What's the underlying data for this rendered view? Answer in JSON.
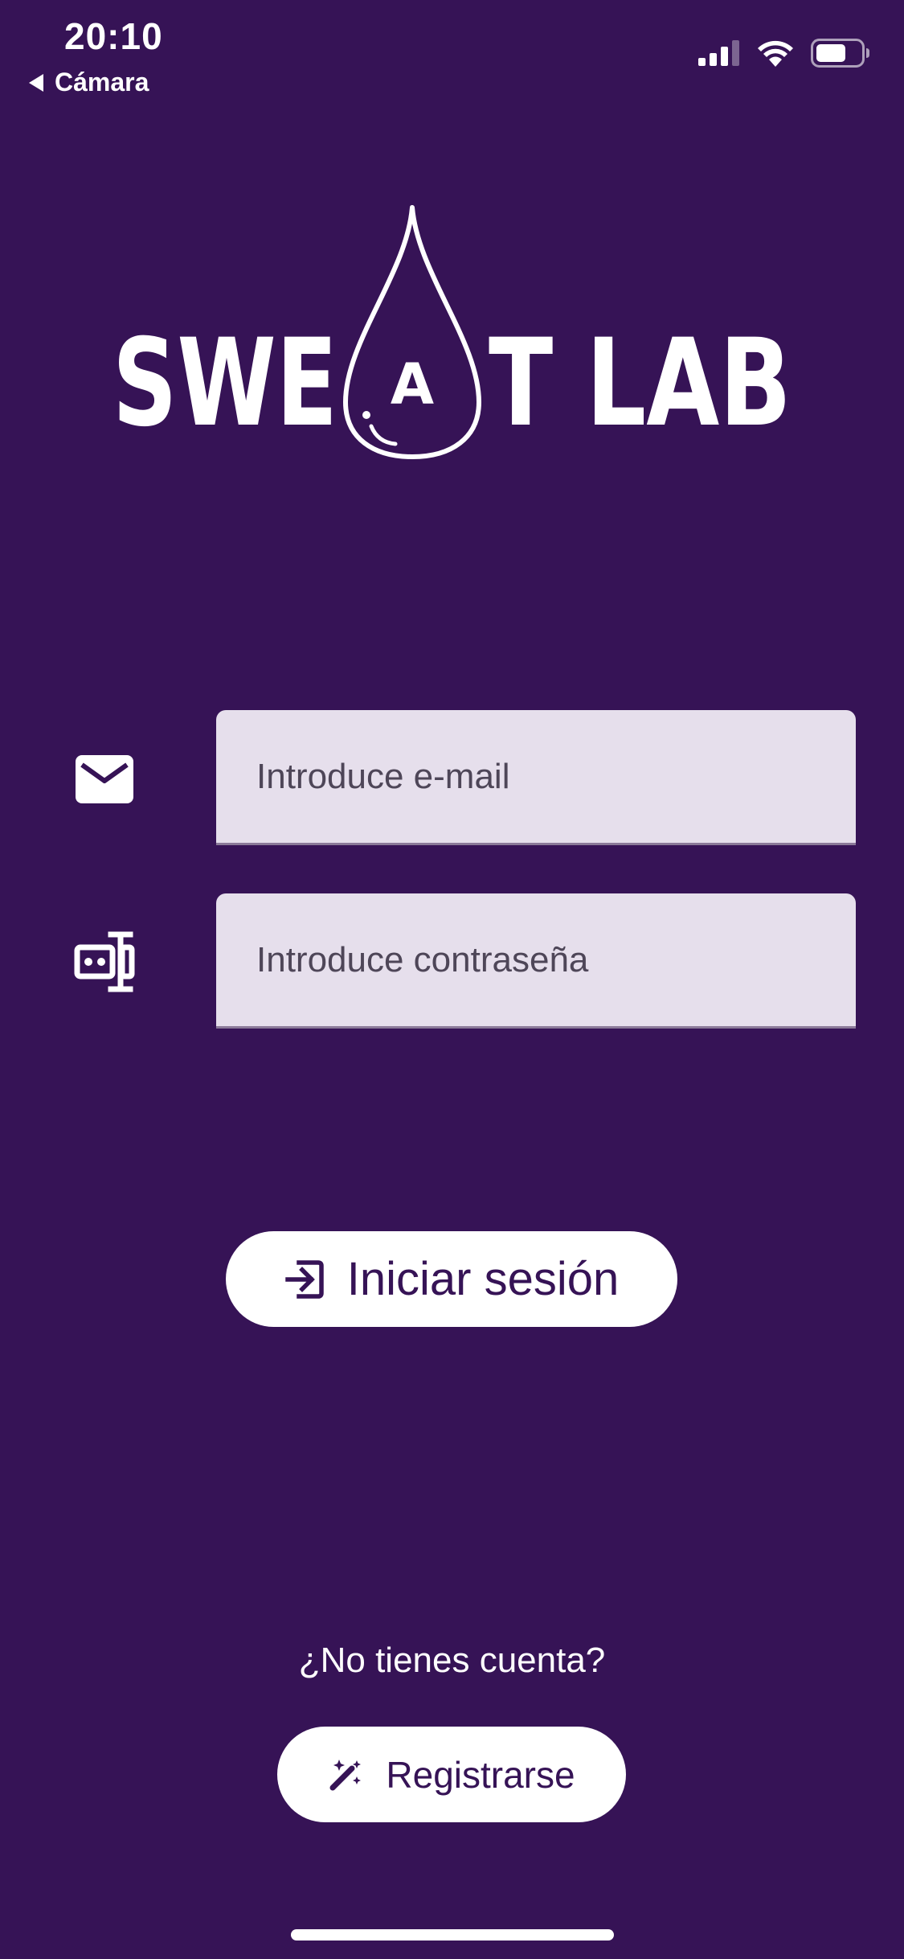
{
  "status_bar": {
    "time": "20:10",
    "back_label": "Cámara",
    "signal_icon": "cellular-signal-icon",
    "wifi_icon": "wifi-icon",
    "battery_icon": "battery-icon"
  },
  "logo": {
    "brand_left": "SWE",
    "brand_drop_letter": "A",
    "brand_right": "T LAB",
    "icon": "water-drop-icon"
  },
  "form": {
    "email": {
      "icon": "envelope-icon",
      "placeholder": "Introduce e-mail",
      "value": ""
    },
    "password": {
      "icon": "password-cursor-icon",
      "placeholder": "Introduce contraseña",
      "value": ""
    },
    "login_button": {
      "icon": "login-arrow-icon",
      "label": "Iniciar sesión"
    }
  },
  "register": {
    "prompt": "¿No tienes cuenta?",
    "button": {
      "icon": "magic-wand-icon",
      "label": "Registrarse"
    }
  },
  "colors": {
    "background": "#361356",
    "input_background": "#e6dfec",
    "button_background": "#ffffff",
    "button_text": "#361356"
  }
}
